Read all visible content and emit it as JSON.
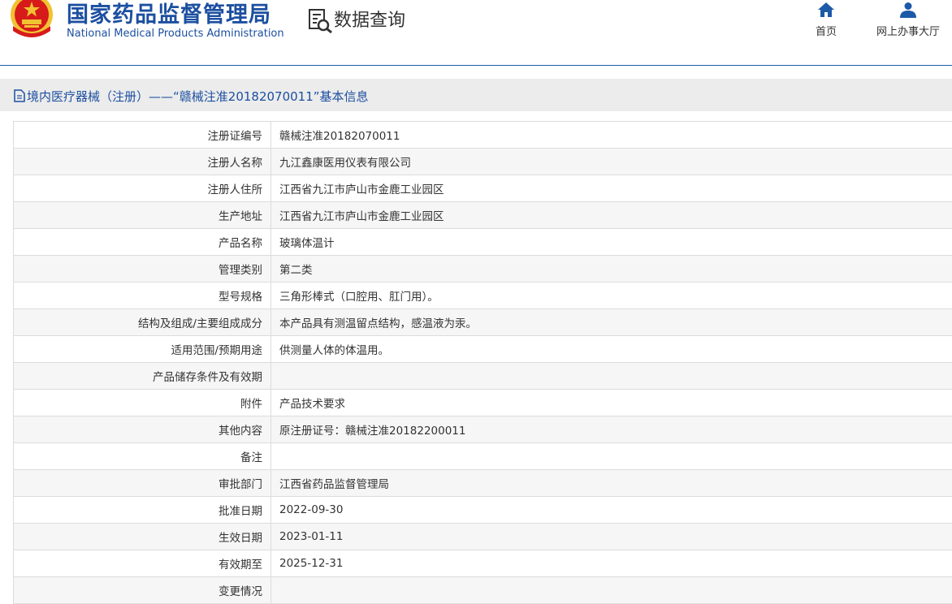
{
  "header": {
    "cn_title": "国家药品监督管理局",
    "en_title": "National Medical Products Administration",
    "query_label": "数据查询",
    "nav": [
      {
        "label": "首页",
        "icon": "home-icon"
      },
      {
        "label": "网上办事大厅",
        "icon": "user-icon"
      }
    ]
  },
  "info": {
    "title": "境内医疗器械（注册）——“赣械注准20182070011”基本信息"
  },
  "colors": {
    "brand_blue": "#1c4fa0",
    "emblem_red": "#d71a1a",
    "emblem_gold": "#f1c232"
  },
  "rows": [
    {
      "label": "注册证编号",
      "value": "赣械注准20182070011"
    },
    {
      "label": "注册人名称",
      "value": "九江鑫康医用仪表有限公司"
    },
    {
      "label": "注册人住所",
      "value": "江西省九江市庐山市金鹿工业园区"
    },
    {
      "label": "生产地址",
      "value": "江西省九江市庐山市金鹿工业园区"
    },
    {
      "label": "产品名称",
      "value": "玻璃体温计"
    },
    {
      "label": "管理类别",
      "value": "第二类"
    },
    {
      "label": "型号规格",
      "value": "三角形棒式（口腔用、肛门用）。"
    },
    {
      "label": "结构及组成/主要组成成分",
      "value": "本产品具有测温留点结构，感温液为汞。"
    },
    {
      "label": "适用范围/预期用途",
      "value": "供测量人体的体温用。"
    },
    {
      "label": "产品储存条件及有效期",
      "value": ""
    },
    {
      "label": "附件",
      "value": "产品技术要求"
    },
    {
      "label": "其他内容",
      "value": "原注册证号：赣械注准20182200011"
    },
    {
      "label": "备注",
      "value": ""
    },
    {
      "label": "审批部门",
      "value": "江西省药品监督管理局"
    },
    {
      "label": "批准日期",
      "value": "2022-09-30"
    },
    {
      "label": "生效日期",
      "value": "2023-01-11"
    },
    {
      "label": "有效期至",
      "value": "2025-12-31"
    },
    {
      "label": "变更情况",
      "value": ""
    }
  ]
}
